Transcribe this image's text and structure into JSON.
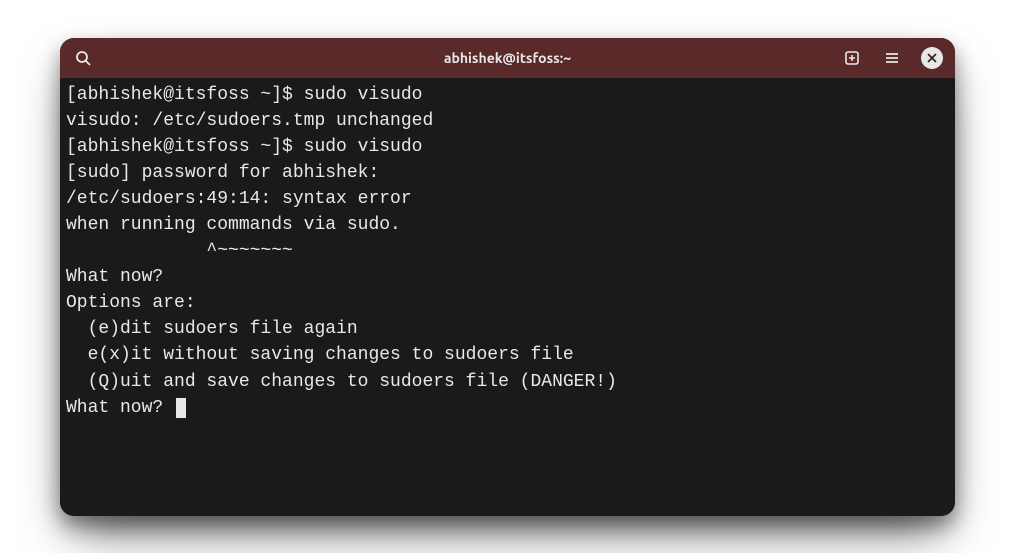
{
  "titlebar": {
    "title": "abhishek@itsfoss:~"
  },
  "terminal": {
    "lines": [
      "[abhishek@itsfoss ~]$ sudo visudo",
      "visudo: /etc/sudoers.tmp unchanged",
      "[abhishek@itsfoss ~]$ sudo visudo",
      "[sudo] password for abhishek:",
      "/etc/sudoers:49:14: syntax error",
      "when running commands via sudo.",
      "             ^~~~~~~~",
      "What now?",
      "Options are:",
      "  (e)dit sudoers file again",
      "  e(x)it without saving changes to sudoers file",
      "  (Q)uit and save changes to sudoers file (DANGER!)",
      "",
      "What now? "
    ]
  }
}
